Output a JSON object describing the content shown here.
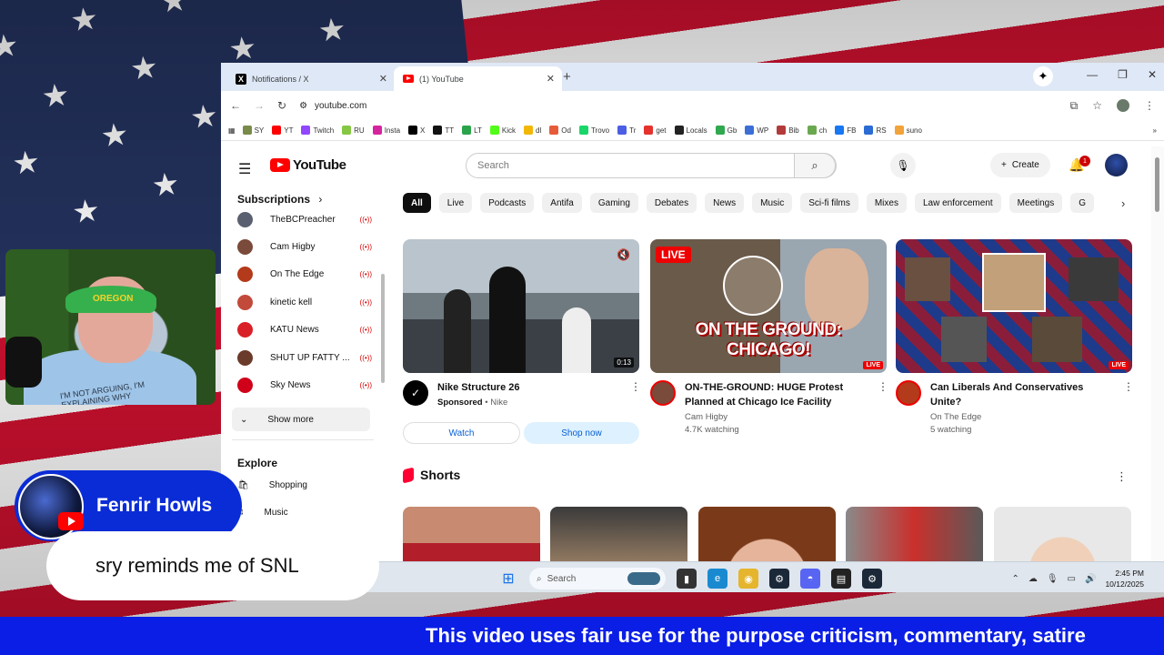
{
  "browser": {
    "tabs": [
      {
        "title": "Notifications / X",
        "active": false
      },
      {
        "title": "(1) YouTube",
        "active": true
      }
    ],
    "url": "youtube.com",
    "bookmarks": [
      {
        "label": "SY",
        "color": "#7a8a4a"
      },
      {
        "label": "YT",
        "color": "#ff0000"
      },
      {
        "label": "Twitch",
        "color": "#9146ff"
      },
      {
        "label": "RU",
        "color": "#85c742"
      },
      {
        "label": "Insta",
        "color": "#d6249f"
      },
      {
        "label": "X",
        "color": "#000000"
      },
      {
        "label": "TT",
        "color": "#111111"
      },
      {
        "label": "LT",
        "color": "#2aa34a"
      },
      {
        "label": "Kick",
        "color": "#53fc18"
      },
      {
        "label": "dl",
        "color": "#f2b705"
      },
      {
        "label": "Od",
        "color": "#e65c3a"
      },
      {
        "label": "Trovo",
        "color": "#19d66b"
      },
      {
        "label": "Tr",
        "color": "#4b5ee4"
      },
      {
        "label": "get",
        "color": "#e5322d"
      },
      {
        "label": "Locals",
        "color": "#222222"
      },
      {
        "label": "Gb",
        "color": "#2fa84f"
      },
      {
        "label": "WP",
        "color": "#3b6fd6"
      },
      {
        "label": "Bib",
        "color": "#b33a3a"
      },
      {
        "label": "ch",
        "color": "#6aa84f"
      },
      {
        "label": "FB",
        "color": "#1877f2"
      },
      {
        "label": "RS",
        "color": "#2b6cd4"
      },
      {
        "label": "suno",
        "color": "#f2a33a"
      }
    ]
  },
  "youtube": {
    "logo_text": "YouTube",
    "search_placeholder": "Search",
    "create_label": "Create",
    "notification_count": "1",
    "sidebar": {
      "subscriptions_title": "Subscriptions",
      "subscriptions": [
        {
          "name": "TheBCPreacher",
          "color": "#5a6070"
        },
        {
          "name": "Cam Higby",
          "color": "#7a4a3a"
        },
        {
          "name": "On The Edge",
          "color": "#b33a1a"
        },
        {
          "name": "kinetic kell",
          "color": "#c24a3a"
        },
        {
          "name": "KATU News",
          "color": "#d92027"
        },
        {
          "name": "SHUT UP FATTY ...",
          "color": "#6a3a2a"
        },
        {
          "name": "Sky News",
          "color": "#d0001a"
        }
      ],
      "show_more": "Show more",
      "explore_title": "Explore",
      "explore": [
        {
          "label": "Shopping"
        },
        {
          "label": "Music"
        }
      ]
    },
    "chips": [
      "All",
      "Live",
      "Podcasts",
      "Antifa",
      "Gaming",
      "Debates",
      "News",
      "Music",
      "Sci-fi films",
      "Mixes",
      "Law enforcement",
      "Meetings",
      "G"
    ],
    "videos": [
      {
        "title": "Nike Structure 26",
        "line1": "Sponsored",
        "line1_suffix": " • Nike",
        "duration": "0:13",
        "watch_label": "Watch",
        "shop_label": "Shop now"
      },
      {
        "title": "ON-THE-GROUND: HUGE Protest Planned at Chicago Ice Facility",
        "channel": "Cam Higby",
        "stats": "4.7K watching",
        "live_label": "LIVE",
        "overlay": "ON THE GROUND: CHICAGO!"
      },
      {
        "title": "Can Liberals And Conservatives Unite?",
        "channel": "On The Edge",
        "stats": "5 watching",
        "live_label": "LIVE"
      }
    ],
    "shorts_title": "Shorts"
  },
  "taskbar": {
    "search_label": "Search",
    "time": "2:45 PM",
    "date": "10/12/2025"
  },
  "overlay": {
    "webcam_hat_text": "OREGON",
    "webcam_shirt_text": "I'M NOT ARGUING, I'M EXPLAINING WHY",
    "chat_name": "Fenrir Howls",
    "chat_message": "sry reminds me of SNL",
    "banner": "This video uses fair use for the purpose criticism, commentary, satire"
  }
}
